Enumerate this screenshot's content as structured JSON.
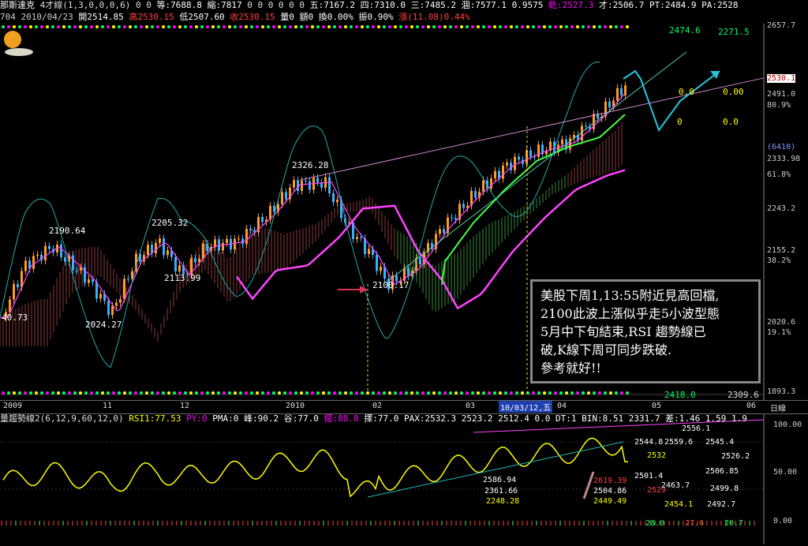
{
  "header": {
    "line1": [
      {
        "text": "那斯達克",
        "color": "#ffffff"
      },
      {
        "text": " 4才線(1,3,0,0,0,6)",
        "color": "#dddddd"
      },
      {
        "text": " 0 0",
        "color": "#dddddd"
      },
      {
        "text": " 等:7688.8",
        "color": "#ffffff"
      },
      {
        "text": " 縮:7817",
        "color": "#ffffff"
      },
      {
        "text": " 0 0 0 0 0 0",
        "color": "#dddddd"
      },
      {
        "text": " 五:7167.2",
        "color": "#ffffff"
      },
      {
        "text": " 四:7310.0",
        "color": "#ffffff"
      },
      {
        "text": " 三:7485.2",
        "color": "#ffffff"
      },
      {
        "text": " 涸:7577.1",
        "color": "#ffffff"
      },
      {
        "text": " 0.9575",
        "color": "#ffffff"
      },
      {
        "text": " 乾:2527.3",
        "color": "#ff00ff"
      },
      {
        "text": " 才:2506.7",
        "color": "#ffffff"
      },
      {
        "text": " PT:2484.9",
        "color": "#ffffff"
      },
      {
        "text": " PA:2528",
        "color": "#ffffff"
      }
    ],
    "line2": [
      {
        "text": "704 ",
        "color": "#cccccc"
      },
      {
        "text": "2010/04/23 ",
        "color": "#cccccc"
      },
      {
        "text": "開2514.85",
        "color": "#ffffff"
      },
      {
        "text": " 高2530.15",
        "color": "#ff4040"
      },
      {
        "text": " 低2507.60",
        "color": "#ffffff"
      },
      {
        "text": " 收2530.15",
        "color": "#ff4040"
      },
      {
        "text": " 量0",
        "color": "#ffffff"
      },
      {
        "text": " 額0",
        "color": "#ffffff"
      },
      {
        "text": " 換0.00%",
        "color": "#ffffff"
      },
      {
        "text": " 振0.90%",
        "color": "#ffffff"
      },
      {
        "text": " 漲(11.08)0.44%",
        "color": "#ff4040"
      }
    ]
  },
  "annotation": {
    "lines": [
      "美股下周1,13:55附近見高回檔,",
      "2100此波上漲似乎走5小波型態",
      "5月中下旬結束,RSI 趨勢線已",
      "破,K線下周可同步跌破.",
      "參考就好!!"
    ]
  },
  "main_labels": [
    {
      "text": "2190.64",
      "color": "#ffffff"
    },
    {
      "text": "2205.32",
      "color": "#ffffff"
    },
    {
      "text": "2326.28",
      "color": "#ffffff"
    },
    {
      "text": "2113.99",
      "color": "#ffffff"
    },
    {
      "text": "2024.27",
      "color": "#ffffff"
    },
    {
      "text": "2100.17",
      "color": "#ffffff"
    },
    {
      "text": "40.73",
      "color": "#ffffff"
    },
    {
      "text": "2474.6",
      "color": "#00ff66"
    },
    {
      "text": "2271.5",
      "color": "#00ff66"
    },
    {
      "text": "0.0",
      "color": "#ffff00"
    },
    {
      "text": "0.00",
      "color": "#ffff00"
    },
    {
      "text": "0",
      "color": "#ffff00"
    },
    {
      "text": "0.0",
      "color": "#ffff00"
    },
    {
      "text": "2418.0",
      "color": "#00ff66"
    },
    {
      "text": "2309.6",
      "color": "#dddddd"
    }
  ],
  "y_axis_main": [
    "2657.7",
    "2530.1",
    "2491.0",
    "80.9%",
    "(6410)",
    "2333.98",
    "61.8%",
    "2243.2",
    "2155.2",
    "38.2%",
    "2020.6",
    "19.1%",
    "1893.3"
  ],
  "x_axis": {
    "ticks": [
      "2009",
      "11",
      "12",
      "2010",
      "02",
      "03",
      "04",
      "05",
      "06"
    ],
    "selected": "10/03/12,五",
    "right": "日線"
  },
  "rsi": {
    "header": [
      {
        "text": "量趨勢線2(6,12,9,60,12,0)",
        "color": "#dddddd"
      },
      {
        "text": " RSI1:77.53",
        "color": "#ffff00"
      },
      {
        "text": " PY:0",
        "color": "#ff00ff"
      },
      {
        "text": " PMA:0",
        "color": "#ffffff"
      },
      {
        "text": " 峰:90.2",
        "color": "#ffffff"
      },
      {
        "text": " 谷:77.0",
        "color": "#ffffff"
      },
      {
        "text": " 擺:88.8",
        "color": "#ff00ff"
      },
      {
        "text": " 擇:77.0",
        "color": "#ffffff"
      },
      {
        "text": " PAX:2532.3",
        "color": "#ffffff"
      },
      {
        "text": " 2523.2",
        "color": "#ffffff"
      },
      {
        "text": " 2512.4",
        "color": "#ffffff"
      },
      {
        "text": " 0.0",
        "color": "#ffffff"
      },
      {
        "text": " DT:1",
        "color": "#ffffff"
      },
      {
        "text": " BIN:8.51",
        "color": "#ffffff"
      },
      {
        "text": " 2331.7",
        "color": "#ffffff"
      },
      {
        "text": " 差:1.46",
        "color": "#ffffff"
      },
      {
        "text": " 1.59",
        "color": "#ffffff"
      },
      {
        "text": " 1.9",
        "color": "#ffffff"
      }
    ],
    "y_axis": [
      "100.00",
      "50.00",
      "0.00"
    ],
    "labels": [
      {
        "text": "2586.94",
        "color": "#ffffff"
      },
      {
        "text": "2361.66",
        "color": "#ffffff"
      },
      {
        "text": "2248.28",
        "color": "#ffff00"
      },
      {
        "text": "2544.8",
        "color": "#ffffff"
      },
      {
        "text": "2559.6",
        "color": "#ffffff"
      },
      {
        "text": "2545.4",
        "color": "#ffffff"
      },
      {
        "text": "2532",
        "color": "#ffff00"
      },
      {
        "text": "2526.2",
        "color": "#ffffff"
      },
      {
        "text": "2501.4",
        "color": "#ffffff"
      },
      {
        "text": "2506.85",
        "color": "#ffffff"
      },
      {
        "text": "2619.39",
        "color": "#ff4040"
      },
      {
        "text": "2504.86",
        "color": "#ffffff"
      },
      {
        "text": "2449.49",
        "color": "#ffff00"
      },
      {
        "text": "2529",
        "color": "#ff4040"
      },
      {
        "text": "2463.7",
        "color": "#ffffff"
      },
      {
        "text": "2499.8",
        "color": "#ffffff"
      },
      {
        "text": "2454.1",
        "color": "#ffff00"
      },
      {
        "text": "2492.7",
        "color": "#ffffff"
      },
      {
        "text": "2556.1",
        "color": "#ffffff"
      },
      {
        "text": "28.0",
        "color": "#00ff66"
      },
      {
        "text": "27.6",
        "color": "#ff4040"
      },
      {
        "text": "20.7",
        "color": "#00ff66"
      }
    ]
  },
  "chart_data": {
    "type": "candlestick",
    "title": "那斯達克",
    "x_range": [
      "2009-09",
      "2010-06"
    ],
    "y_range": [
      1893.3,
      2657.7
    ],
    "key_points": [
      {
        "label": "2190.64",
        "value": 2190.64
      },
      {
        "label": "2205.32",
        "value": 2205.32
      },
      {
        "label": "2326.28",
        "value": 2326.28
      },
      {
        "label": "2113.99",
        "value": 2113.99
      },
      {
        "label": "2024.27",
        "value": 2024.27
      },
      {
        "label": "2100.17",
        "value": 2100.17
      },
      {
        "label": "close 2010/04/23",
        "value": 2530.15
      }
    ],
    "fib_levels": [
      {
        "pct": "80.9%",
        "value": 2491.0
      },
      {
        "pct": "61.8%",
        "value": 2333.98
      },
      {
        "pct": "38.2%",
        "value": 2155.2
      },
      {
        "pct": "19.1%",
        "value": 2020.6
      }
    ],
    "rsi": {
      "name": "RSI1",
      "last": 77.53,
      "ylim": [
        0,
        100
      ]
    }
  }
}
